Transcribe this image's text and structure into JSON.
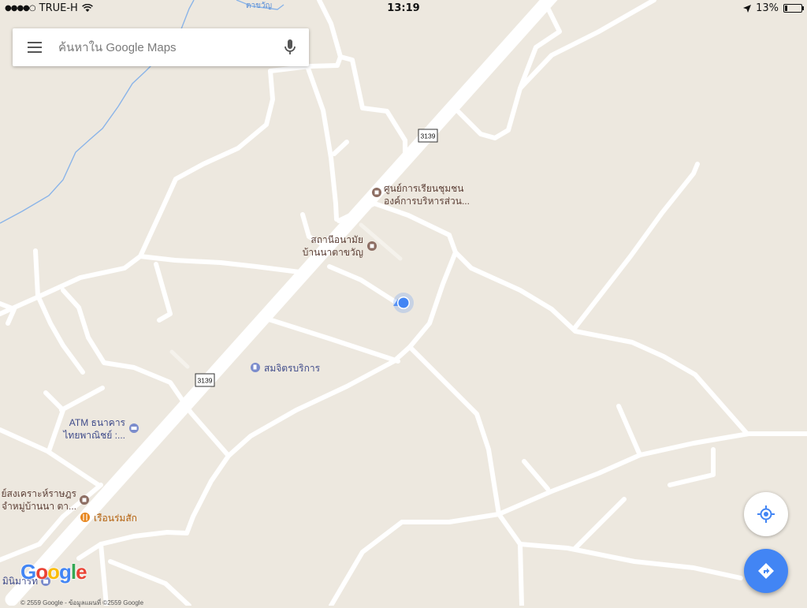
{
  "status_bar": {
    "carrier": "TRUE-H",
    "time": "13:19",
    "battery": "13%"
  },
  "search": {
    "placeholder": "ค้นหาใน Google Maps"
  },
  "icons": {
    "menu": "hamburger-menu-icon",
    "mic": "microphone-icon",
    "location": "my-location-icon",
    "directions": "directions-icon"
  },
  "colors": {
    "map_background": "#ede8df",
    "road": "#ffffff",
    "water": "#8ab4e8",
    "poi_brown": "#8d6e63",
    "poi_blue": "#7b8ccc",
    "poi_orange": "#e8871e",
    "location_dot": "#4285f4",
    "directions_button": "#4285f4"
  },
  "map": {
    "road_shields": [
      "3139",
      "3139"
    ],
    "top_road_label": "ตาขวัญ",
    "places": [
      {
        "lines": [
          "ศูนย์การเรียนชุมชน",
          "องค์การบริหารส่วน..."
        ],
        "icon": "museum-icon"
      },
      {
        "lines": [
          "สถานีอนามัย",
          "บ้านนาตาขวัญ"
        ],
        "icon": "museum-icon"
      },
      {
        "lines": [
          "สมจิตรบริการ"
        ],
        "icon": "gas-station-icon"
      },
      {
        "lines": [
          "ATM ธนาคาร",
          "ไทยพาณิชย์ :..."
        ],
        "icon": "atm-icon"
      },
      {
        "lines": [
          "ย์สงเคราะห์ราษฎร",
          "จำหมู่บ้านนา ตา..."
        ],
        "icon": "museum-icon"
      },
      {
        "lines": [
          "เรือนร่มสัก"
        ],
        "icon": "restaurant-icon"
      },
      {
        "lines": [
          "มินิมาร์ท"
        ],
        "icon": "shopping-icon"
      }
    ]
  },
  "branding": {
    "logo": "Google",
    "attribution": "© 2559 Google - ข้อมูลแผนที่ ©2559 Google"
  }
}
